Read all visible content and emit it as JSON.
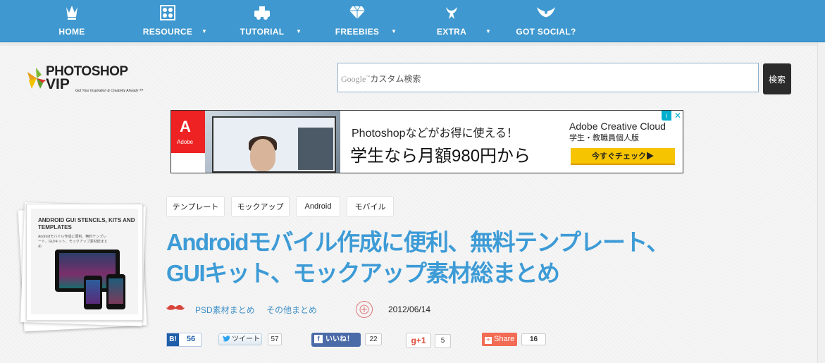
{
  "nav": {
    "items": [
      {
        "label": "HOME",
        "icon": "crown-icon",
        "caret": false
      },
      {
        "label": "RESOURCE",
        "icon": "resource-icon",
        "caret": true
      },
      {
        "label": "TUTORIAL",
        "icon": "tutorial-icon",
        "caret": true
      },
      {
        "label": "FREEBIES",
        "icon": "diamond-icon",
        "caret": true
      },
      {
        "label": "EXTRA",
        "icon": "bird-icon",
        "caret": true
      },
      {
        "label": "GOT SOCIAL?",
        "icon": "wings-icon",
        "caret": false
      }
    ],
    "caret_glyph": "▼",
    "color": "#3f98cf"
  },
  "logo": {
    "line1": "PHOTOSHOP",
    "line2": "VIP",
    "tagline": "Got Your Inspiration & Creativity Already ??"
  },
  "search": {
    "google": "Google",
    "tm": "™",
    "placeholder": "カスタム検索",
    "button_label": "検索"
  },
  "ad": {
    "logo_letter": "A",
    "logo_text": "Adobe",
    "line1": "Photoshopなどがお得に使える！",
    "line2": "学生なら月額980円から",
    "brand": "Adobe Creative Cloud",
    "sub": "学生・教職員個人版",
    "cta": "今すぐチェック▶",
    "info": "i",
    "close": "✕"
  },
  "article": {
    "thumb_title": "ANDROID GUI STENCILS, KITS AND TEMPLATES",
    "thumb_sub": "Androidモバイル作成に便利、無料テンプレート、GUIキット、モックアップ素材総まとめ",
    "tags": [
      "テンプレート",
      "モックアップ",
      "Android",
      "モバイル"
    ],
    "title": "Androidモバイル作成に便利、無料テンプレート、GUIキット、モックアップ素材総まとめ",
    "categories": [
      "PSD素材まとめ",
      "その他まとめ"
    ],
    "date": "2012/06/14"
  },
  "share": {
    "hatena": {
      "label": "B!",
      "count": "56"
    },
    "twitter": {
      "label": "ツイート",
      "count": "57"
    },
    "facebook": {
      "label": "いいね！",
      "count": "22"
    },
    "gplus": {
      "label": "g+1",
      "count": "5"
    },
    "addthis": {
      "label": "Share",
      "count": "16"
    }
  }
}
